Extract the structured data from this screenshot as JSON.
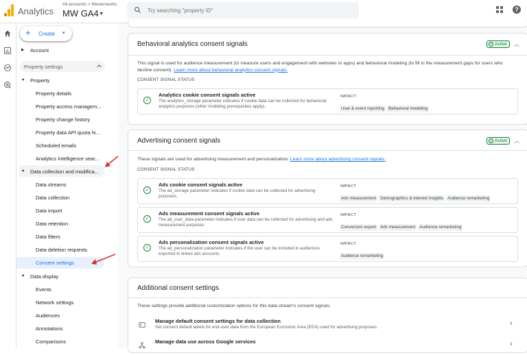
{
  "header": {
    "app_name": "Analytics",
    "breadcrumb": "All accounts > Masterworks",
    "property_name": "MW GA4",
    "property_caret": "▾",
    "search_placeholder": "Try searching \"property ID\"",
    "help_glyph": "?"
  },
  "colors": {
    "brand_orange": "#f9ab00",
    "brand_orange_dark": "#e37400",
    "accent_blue": "#1a73e8",
    "active_green": "#188038",
    "annotation_red": "#d93025"
  },
  "rail": {
    "icons": [
      "home-icon",
      "reports-icon",
      "explore-icon",
      "advertising-icon"
    ]
  },
  "sidenav": {
    "create_label": "Create",
    "create_plus": "+",
    "create_caret": "▾",
    "account_label": "Account",
    "property_settings_label": "Property settings",
    "property_label": "Property",
    "property_items": [
      "Property details",
      "Property access managem...",
      "Property change history",
      "Property data API quota hi...",
      "Scheduled emails",
      "Analytics Intelligence sear..."
    ],
    "data_collection_label": "Data collection and modifica...",
    "data_collection_items": [
      "Data streams",
      "Data collection",
      "Data import",
      "Data retention",
      "Data filters",
      "Data deletion requests",
      "Consent settings"
    ],
    "data_display_label": "Data display",
    "data_display_items": [
      "Events",
      "Network settings",
      "Audiences",
      "Annotations",
      "Comparisons"
    ]
  },
  "behavioral": {
    "title": "Behavioral analytics consent signals",
    "badge": "Active",
    "description": "This signal is used for audience measurement (to measure users and engagement with websites or apps) and behavioral modeling (to fill in the measurement gaps for users who decline consent).",
    "link": "Learn more about behavioral analytics consent signals.",
    "status_label": "CONSENT SIGNAL STATUS",
    "signals": [
      {
        "title": "Analytics cookie consent signals active",
        "description": "The analytics_storage parameter indicates if cookie data can be collected for behavioral analytics purposes (other modeling prerequisites apply).",
        "impact_label": "IMPACT",
        "chips": [
          "User & event reporting",
          "Behavioral modeling"
        ]
      }
    ]
  },
  "advertising": {
    "title": "Advertising consent signals",
    "badge": "Active",
    "description": "These signals are used for advertising measurement and personalization.",
    "link": "Learn more about advertising consent signals.",
    "status_label": "CONSENT SIGNAL STATUS",
    "signals": [
      {
        "title": "Ads cookie consent signals active",
        "description": "The ad_storage parameter indicates if cookie data can be collected for advertising purposes.",
        "impact_label": "IMPACT",
        "chips": [
          "Ads measurement",
          "Demographics & interest insights",
          "Audience remarketing"
        ]
      },
      {
        "title": "Ads measurement consent signals active",
        "description": "The ad_user_data parameter indicates if user data can be collected for advertising and ads measurement purposes.",
        "impact_label": "IMPACT",
        "chips": [
          "Conversion export",
          "Ads measurement",
          "Audience remarketing"
        ]
      },
      {
        "title": "Ads personalization consent signals active",
        "description": "The ad_personalization parameter indicates if the user can be included in audiences exported to linked ads accounts.",
        "impact_label": "IMPACT",
        "chips": [
          "Audience remarketing"
        ]
      }
    ]
  },
  "additional": {
    "title": "Additional consent settings",
    "description": "These settings provide additional customization options for this data stream's consent signals.",
    "rows": [
      {
        "title": "Manage default consent settings for data collection",
        "description": "Set consent default labels for end-user data from the European Economic Area (EEA) used for advertising purposes."
      },
      {
        "title": "Manage data use across Google services",
        "description": ""
      }
    ]
  }
}
